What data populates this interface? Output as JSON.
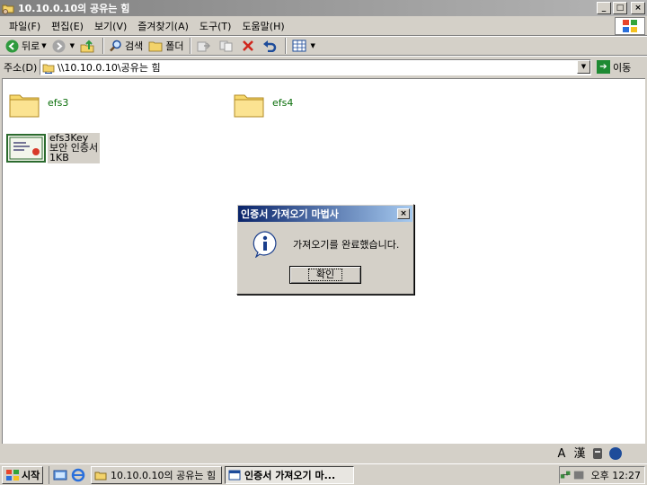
{
  "window": {
    "title": "10.10.0.10의 공유는 힘",
    "controls": {
      "minimize": "_",
      "maximize": "□",
      "close": "×"
    }
  },
  "menu": {
    "items": [
      "파일(F)",
      "편집(E)",
      "보기(V)",
      "즐겨찾기(A)",
      "도구(T)",
      "도움말(H)"
    ]
  },
  "toolbar": {
    "back_label": "뒤로",
    "search_label": "검색",
    "folders_label": "폴더"
  },
  "address": {
    "label": "주소(D)",
    "value": "\\\\10.10.0.10\\공유는 힘",
    "go_label": "이동"
  },
  "files": [
    {
      "name": "efs3",
      "icon": "folder-icon"
    },
    {
      "name": "efs4",
      "icon": "folder-icon"
    }
  ],
  "certificate_file": {
    "name": "efs3Key",
    "type": "보안 인증서",
    "size": "1KB",
    "icon": "certificate-icon"
  },
  "dialog": {
    "title": "인증서 가져오기 마법사",
    "message": "가져오기를 완료했습니다.",
    "ok_label": "확인",
    "close": "×"
  },
  "language_bar": {
    "mode": "A",
    "hanja": "漢",
    "help": "?"
  },
  "taskbar": {
    "start_label": "시작",
    "tasks": [
      {
        "label": "10.10.0.10의 공유는 힘",
        "active": false
      },
      {
        "label": "인증서 가져오기 마...",
        "active": true
      }
    ],
    "clock": "오후 12:27"
  },
  "colors": {
    "titlebar_inactive": "#808080",
    "dialog_titlebar": "#0a246a",
    "window_face": "#d4d0c8",
    "filename_green": "#0a6e0a"
  }
}
